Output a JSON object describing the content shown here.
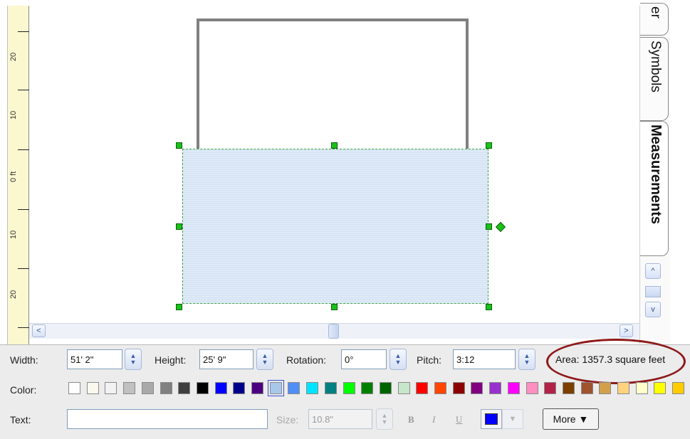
{
  "ruler": {
    "labels": [
      "20",
      "10",
      "0 ft",
      "10",
      "20"
    ]
  },
  "tabs": [
    {
      "label": "er"
    },
    {
      "label": "Symbols"
    },
    {
      "label": "Measurements"
    }
  ],
  "scroll": {
    "left": "<",
    "right": ">",
    "up": "^",
    "down": "v"
  },
  "panel": {
    "width_label": "Width:",
    "width_value": "51' 2\"",
    "height_label": "Height:",
    "height_value": "25' 9\"",
    "rotation_label": "Rotation:",
    "rotation_value": "0°",
    "pitch_label": "Pitch:",
    "pitch_value": "3:12",
    "area_text": "Area: 1357.3 square feet",
    "color_label": "Color:",
    "text_label": "Text:",
    "text_value": "",
    "size_label": "Size:",
    "size_value": "10.8\"",
    "bold": "B",
    "italic": "I",
    "underline": "U",
    "more_label": "More ▼"
  },
  "colors": [
    "#ffffff",
    "#fbf8ef",
    "#f2f2f2",
    "#c0c0c0",
    "#a9a9a9",
    "#808080",
    "#404040",
    "#000000",
    "#0000ff",
    "#00008b",
    "#4b0082",
    "#a9c7ea",
    "#4f8ef7",
    "#00e5ff",
    "#008080",
    "#00ff00",
    "#008000",
    "#006400",
    "#c8e6c9",
    "#ff0000",
    "#ff4500",
    "#8b0000",
    "#800080",
    "#9932cc",
    "#ff00ff",
    "#ff8fc0",
    "#b22248",
    "#7b3f00",
    "#a0522d",
    "#d2a04a",
    "#ffd27f",
    "#ffffcc",
    "#ffff00",
    "#ffcc00"
  ],
  "selected_color_index": 11,
  "text_color": "#0000ff"
}
